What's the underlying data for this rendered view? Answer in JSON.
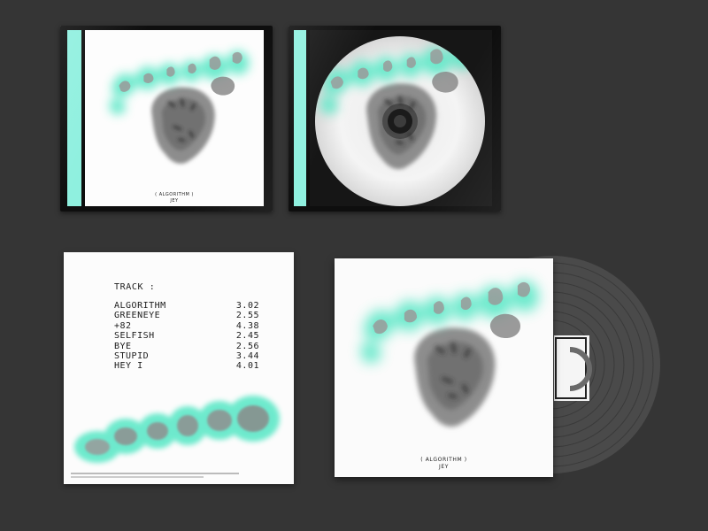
{
  "album": {
    "title": "( ALGORITHM )",
    "artist": "JEY"
  },
  "back_cover": {
    "track_header": "TRACK :",
    "tracks": [
      {
        "name": "ALGORITHM",
        "time": "3.02"
      },
      {
        "name": "GREENEYE",
        "time": "2.55"
      },
      {
        "name": "+82",
        "time": "4.38"
      },
      {
        "name": "SELFISH",
        "time": "2.45"
      },
      {
        "name": "BYE",
        "time": "2.56"
      },
      {
        "name": "STUPID",
        "time": "3.44"
      },
      {
        "name": "HEY I",
        "time": "4.01"
      }
    ]
  },
  "colors": {
    "background": "#353535",
    "accent_mint": "#8ff0df",
    "glow_green": "#5ee8c8",
    "vinyl": "#4a4a4a"
  },
  "icons": {
    "record": "vinyl-record-icon",
    "disc": "compact-disc-icon"
  }
}
